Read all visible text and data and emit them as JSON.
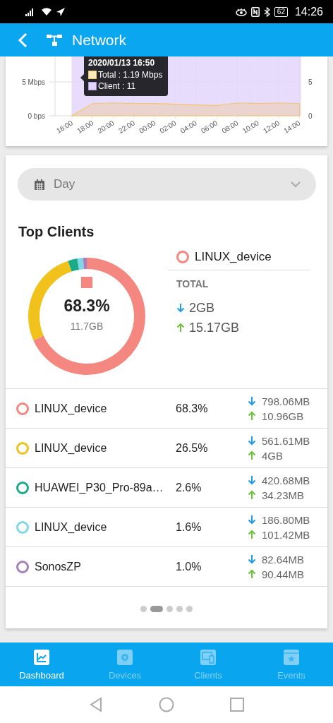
{
  "status_bar": {
    "battery": "62",
    "time": "14:26"
  },
  "app_bar": {
    "title": "Network"
  },
  "traffic_chart": {
    "tooltip": {
      "title": "2020/01/13 16:50",
      "lines": [
        {
          "kind": "total",
          "text": "Total : 1.19 Mbps"
        },
        {
          "kind": "client",
          "text": "Client : 11"
        }
      ]
    },
    "right_axis": {
      "ticks": [
        "5",
        "0"
      ]
    },
    "chart_data": {
      "type": "area",
      "x": [
        "16:00",
        "18:00",
        "20:00",
        "22:00",
        "00:00",
        "02:00",
        "04:00",
        "06:00",
        "08:00",
        "10:00",
        "12:00",
        "14:00"
      ],
      "ylim": [
        0,
        8.75
      ],
      "yticks": [
        {
          "value": 0,
          "label": "0 bps"
        },
        {
          "value": 5,
          "label": "5 Mbps"
        }
      ],
      "series": [
        {
          "color": "#f5c56a",
          "values": [
            0,
            1.8,
            1.9,
            1.8,
            1.8,
            1.7,
            1.6,
            1.5,
            1.9,
            1.8,
            1.9,
            1.8
          ]
        }
      ]
    }
  },
  "period_select": {
    "value": "Day"
  },
  "top_clients": {
    "title": "Top Clients",
    "chart_data": {
      "type": "donut",
      "values": [
        68.3,
        26.5,
        2.6,
        1.6,
        1.0
      ]
    },
    "center": {
      "percent": "68.3%",
      "amount": "11.7GB"
    },
    "detail": {
      "name": "LINUX_device",
      "color": "#f4877f",
      "total_label": "TOTAL",
      "download": "2GB",
      "upload": "15.17GB"
    },
    "clients": [
      {
        "name": "LINUX_device",
        "color": "#f4877f",
        "share": "68.3%",
        "download": "798.06MB",
        "upload": "10.96GB"
      },
      {
        "name": "LINUX_device",
        "color": "#f1c21b",
        "share": "26.5%",
        "download": "561.61MB",
        "upload": "4GB"
      },
      {
        "name": "HUAWEI_P30_Pro-89a…",
        "color": "#1aab8a",
        "share": "2.6%",
        "download": "420.68MB",
        "upload": "34.23MB"
      },
      {
        "name": "LINUX_device",
        "color": "#7fd8e6",
        "share": "1.6%",
        "download": "186.80MB",
        "upload": "101.42MB"
      },
      {
        "name": "SonosZP",
        "color": "#a77fbc",
        "share": "1.0%",
        "download": "82.64MB",
        "upload": "90.44MB"
      }
    ],
    "pages": [
      {
        "selected": false
      },
      {
        "selected": true
      },
      {
        "selected": false
      },
      {
        "selected": false
      },
      {
        "selected": false
      }
    ]
  },
  "bottom_nav": [
    {
      "label": "Dashboard",
      "kind": "dashboard",
      "selected": true
    },
    {
      "label": "Devices",
      "kind": "devices",
      "selected": false
    },
    {
      "label": "Clients",
      "kind": "clients",
      "selected": false
    },
    {
      "label": "Events",
      "kind": "events",
      "selected": false
    }
  ]
}
